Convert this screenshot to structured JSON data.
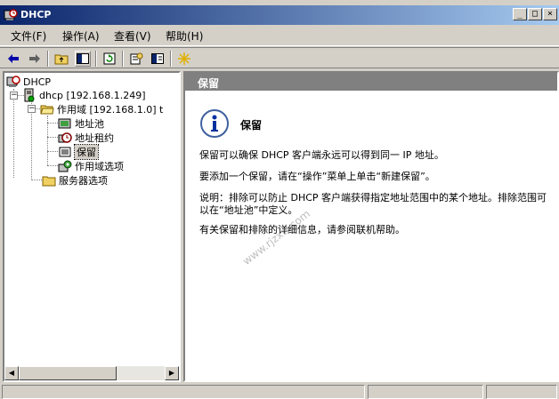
{
  "window": {
    "title": "DHCP",
    "icon": "dhcp-console-icon",
    "controls": [
      "_",
      "□",
      "×"
    ]
  },
  "menubar": {
    "items": [
      "文件(F)",
      "操作(A)",
      "查看(V)",
      "帮助(H)"
    ]
  },
  "toolbar": {
    "buttons": [
      "back-arrow-icon",
      "forward-arrow-icon",
      "up-folder-icon",
      "show-hide-tree-icon",
      "refresh-icon",
      "properties-icon",
      "help-icon",
      "new-item-icon"
    ]
  },
  "tree": {
    "root": "DHCP",
    "server": "dhcp [192.168.1.249]",
    "scope": "作用域 [192.168.1.0] t",
    "scope_children": [
      "地址池",
      "地址租约",
      "保留",
      "作用域选项"
    ],
    "server_options": "服务器选项",
    "selected": "保留"
  },
  "content": {
    "header": "保留",
    "info_title": "保留",
    "paragraphs": [
      "保留可以确保 DHCP 客户端永远可以得到同一 IP 地址。",
      "要添加一个保留，请在“操作”菜单上单击“新建保留”。",
      "说明：排除可以防止 DHCP 客户端获得指定地址范围中的某个地址。排除范围可以在“地址池”中定义。",
      "有关保留和排除的详细信息，请参阅联机帮助。"
    ],
    "watermark": "www.rjzxw.com"
  },
  "colors": {
    "title_gradient_start": "#0a246a",
    "title_gradient_end": "#a6caf0",
    "face": "#d4d0c8",
    "pane_header": "#808080"
  }
}
